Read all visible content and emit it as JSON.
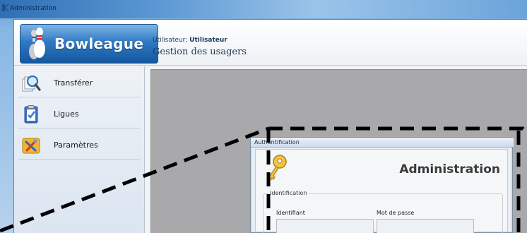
{
  "window": {
    "title": "Administration"
  },
  "header": {
    "logo_text": "Bowleague",
    "user_label": "Utilisateur:",
    "user_value": "Utilisateur",
    "page_title": "Gestion des usagers"
  },
  "sidebar": {
    "items": [
      {
        "label": "Transférer",
        "icon": "magnifier-document-icon"
      },
      {
        "label": "Ligues",
        "icon": "checklist-icon"
      },
      {
        "label": "Paramètres",
        "icon": "tools-icon"
      }
    ]
  },
  "dialog": {
    "title": "Authentification",
    "heading": "Administration",
    "group_label": "Identification",
    "username_label": "Identifiant",
    "password_label": "Mot de passe",
    "username_value": "",
    "password_value": ""
  },
  "colors": {
    "accent": "#2f79c4",
    "content_bg": "#a9a9ab",
    "annotation": "#000000"
  }
}
